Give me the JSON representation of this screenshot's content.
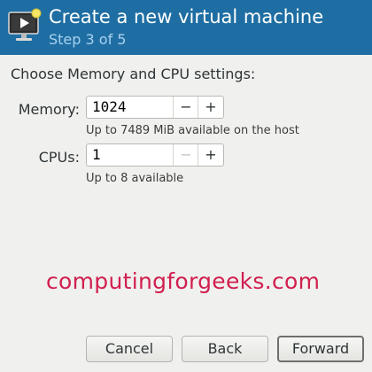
{
  "header": {
    "title": "Create a new virtual machine",
    "subtitle": "Step 3 of 5",
    "icon": "virtual-machine-monitor-icon"
  },
  "content": {
    "section_title": "Choose Memory and CPU settings:",
    "memory": {
      "label": "Memory:",
      "value": "1024",
      "decrement": "−",
      "increment": "+",
      "hint": "Up to 7489 MiB available on the host"
    },
    "cpus": {
      "label": "CPUs:",
      "value": "1",
      "decrement": "−",
      "increment": "+",
      "hint": "Up to 8 available"
    }
  },
  "watermark": "computingforgeeks.com",
  "footer": {
    "cancel": "Cancel",
    "back": "Back",
    "forward": "Forward"
  },
  "colors": {
    "header_bg": "#1f6ea3",
    "watermark": "#d11f4f"
  }
}
